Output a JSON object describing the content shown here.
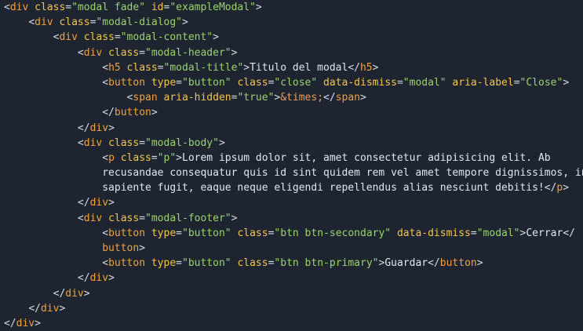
{
  "colors": {
    "background": "#1e2530",
    "tag": "#f0a23a",
    "attribute": "#f3c646",
    "string": "#9ad36c",
    "text": "#e2e6ee",
    "punctuation": "#d6dbe3",
    "entity": "#e89d62"
  },
  "lines": [
    [
      [
        "p",
        "<"
      ],
      [
        "tag",
        "div"
      ],
      [
        "w",
        " "
      ],
      [
        "attr",
        "class"
      ],
      [
        "eq",
        "="
      ],
      [
        "str",
        "\"modal fade\""
      ],
      [
        "w",
        " "
      ],
      [
        "attr",
        "id"
      ],
      [
        "eq",
        "="
      ],
      [
        "str",
        "\"exampleModal\""
      ],
      [
        "p",
        ">"
      ]
    ],
    [
      [
        "w",
        "    "
      ],
      [
        "p",
        "<"
      ],
      [
        "tag",
        "div"
      ],
      [
        "w",
        " "
      ],
      [
        "attr",
        "class"
      ],
      [
        "eq",
        "="
      ],
      [
        "str",
        "\"modal-dialog\""
      ],
      [
        "p",
        ">"
      ]
    ],
    [
      [
        "w",
        "        "
      ],
      [
        "p",
        "<"
      ],
      [
        "tag",
        "div"
      ],
      [
        "w",
        " "
      ],
      [
        "attr",
        "class"
      ],
      [
        "eq",
        "="
      ],
      [
        "str",
        "\"modal-content\""
      ],
      [
        "p",
        ">"
      ]
    ],
    [
      [
        "w",
        "            "
      ],
      [
        "p",
        "<"
      ],
      [
        "tag",
        "div"
      ],
      [
        "w",
        " "
      ],
      [
        "attr",
        "class"
      ],
      [
        "eq",
        "="
      ],
      [
        "str",
        "\"modal-header\""
      ],
      [
        "p",
        ">"
      ]
    ],
    [
      [
        "w",
        "                "
      ],
      [
        "p",
        "<"
      ],
      [
        "tag",
        "h5"
      ],
      [
        "w",
        " "
      ],
      [
        "attr",
        "class"
      ],
      [
        "eq",
        "="
      ],
      [
        "str",
        "\"modal-title\""
      ],
      [
        "p",
        ">"
      ],
      [
        "text",
        "Titulo del modal"
      ],
      [
        "p",
        "</"
      ],
      [
        "tag",
        "h5"
      ],
      [
        "p",
        ">"
      ]
    ],
    [
      [
        "w",
        "                "
      ],
      [
        "p",
        "<"
      ],
      [
        "tag",
        "button"
      ],
      [
        "w",
        " "
      ],
      [
        "attr",
        "type"
      ],
      [
        "eq",
        "="
      ],
      [
        "str",
        "\"button\""
      ],
      [
        "w",
        " "
      ],
      [
        "attr",
        "class"
      ],
      [
        "eq",
        "="
      ],
      [
        "str",
        "\"close\""
      ],
      [
        "w",
        " "
      ],
      [
        "attr",
        "data-dismiss"
      ],
      [
        "eq",
        "="
      ],
      [
        "str",
        "\"modal\""
      ],
      [
        "w",
        " "
      ],
      [
        "attr",
        "aria-label"
      ],
      [
        "eq",
        "="
      ],
      [
        "str",
        "\"Close\""
      ],
      [
        "p",
        ">"
      ]
    ],
    [
      [
        "w",
        "                    "
      ],
      [
        "p",
        "<"
      ],
      [
        "tag",
        "span"
      ],
      [
        "w",
        " "
      ],
      [
        "attr",
        "aria-hidden"
      ],
      [
        "eq",
        "="
      ],
      [
        "str",
        "\"true\""
      ],
      [
        "p",
        ">"
      ],
      [
        "ent",
        "&times;"
      ],
      [
        "p",
        "</"
      ],
      [
        "tag",
        "span"
      ],
      [
        "p",
        ">"
      ]
    ],
    [
      [
        "w",
        "                "
      ],
      [
        "p",
        "</"
      ],
      [
        "tag",
        "button"
      ],
      [
        "p",
        ">"
      ]
    ],
    [
      [
        "w",
        "            "
      ],
      [
        "p",
        "</"
      ],
      [
        "tag",
        "div"
      ],
      [
        "p",
        ">"
      ]
    ],
    [
      [
        "w",
        "            "
      ],
      [
        "p",
        "<"
      ],
      [
        "tag",
        "div"
      ],
      [
        "w",
        " "
      ],
      [
        "attr",
        "class"
      ],
      [
        "eq",
        "="
      ],
      [
        "str",
        "\"modal-body\""
      ],
      [
        "p",
        ">"
      ]
    ],
    [
      [
        "w",
        "                "
      ],
      [
        "p",
        "<"
      ],
      [
        "tag",
        "p"
      ],
      [
        "w",
        " "
      ],
      [
        "attr",
        "class"
      ],
      [
        "eq",
        "="
      ],
      [
        "str",
        "\"p\""
      ],
      [
        "p",
        ">"
      ],
      [
        "text",
        "Lorem ipsum dolor sit, amet consectetur adipisicing elit. Ab"
      ]
    ],
    [
      [
        "w",
        "                "
      ],
      [
        "text",
        "recusandae consequatur quis id sint quidem rem vel amet tempore dignissimos, in"
      ]
    ],
    [
      [
        "w",
        "                "
      ],
      [
        "text",
        "sapiente fugit, eaque neque eligendi repellendus alias nesciunt debitis!"
      ],
      [
        "p",
        "</"
      ],
      [
        "tag",
        "p"
      ],
      [
        "p",
        ">"
      ]
    ],
    [
      [
        "w",
        "            "
      ],
      [
        "p",
        "</"
      ],
      [
        "tag",
        "div"
      ],
      [
        "p",
        ">"
      ]
    ],
    [
      [
        "w",
        "            "
      ],
      [
        "p",
        "<"
      ],
      [
        "tag",
        "div"
      ],
      [
        "w",
        " "
      ],
      [
        "attr",
        "class"
      ],
      [
        "eq",
        "="
      ],
      [
        "str",
        "\"modal-footer\""
      ],
      [
        "p",
        ">"
      ]
    ],
    [
      [
        "w",
        "                "
      ],
      [
        "p",
        "<"
      ],
      [
        "tag",
        "button"
      ],
      [
        "w",
        " "
      ],
      [
        "attr",
        "type"
      ],
      [
        "eq",
        "="
      ],
      [
        "str",
        "\"button\""
      ],
      [
        "w",
        " "
      ],
      [
        "attr",
        "class"
      ],
      [
        "eq",
        "="
      ],
      [
        "str",
        "\"btn btn-secondary\""
      ],
      [
        "w",
        " "
      ],
      [
        "attr",
        "data-dismiss"
      ],
      [
        "eq",
        "="
      ],
      [
        "str",
        "\"modal\""
      ],
      [
        "p",
        ">"
      ],
      [
        "text",
        "Cerrar"
      ],
      [
        "p",
        "</"
      ]
    ],
    [
      [
        "w",
        "                "
      ],
      [
        "tag",
        "button"
      ],
      [
        "p",
        ">"
      ]
    ],
    [
      [
        "w",
        "                "
      ],
      [
        "p",
        "<"
      ],
      [
        "tag",
        "button"
      ],
      [
        "w",
        " "
      ],
      [
        "attr",
        "type"
      ],
      [
        "eq",
        "="
      ],
      [
        "str",
        "\"button\""
      ],
      [
        "w",
        " "
      ],
      [
        "attr",
        "class"
      ],
      [
        "eq",
        "="
      ],
      [
        "str",
        "\"btn btn-primary\""
      ],
      [
        "p",
        ">"
      ],
      [
        "text",
        "Guardar"
      ],
      [
        "p",
        "</"
      ],
      [
        "tag",
        "button"
      ],
      [
        "p",
        ">"
      ]
    ],
    [
      [
        "w",
        "            "
      ],
      [
        "p",
        "</"
      ],
      [
        "tag",
        "div"
      ],
      [
        "p",
        ">"
      ]
    ],
    [
      [
        "w",
        "        "
      ],
      [
        "p",
        "</"
      ],
      [
        "tag",
        "div"
      ],
      [
        "p",
        ">"
      ]
    ],
    [
      [
        "w",
        "    "
      ],
      [
        "p",
        "</"
      ],
      [
        "tag",
        "div"
      ],
      [
        "p",
        ">"
      ]
    ],
    [
      [
        "p",
        "</"
      ],
      [
        "tag",
        "div"
      ],
      [
        "p",
        ">"
      ]
    ]
  ]
}
